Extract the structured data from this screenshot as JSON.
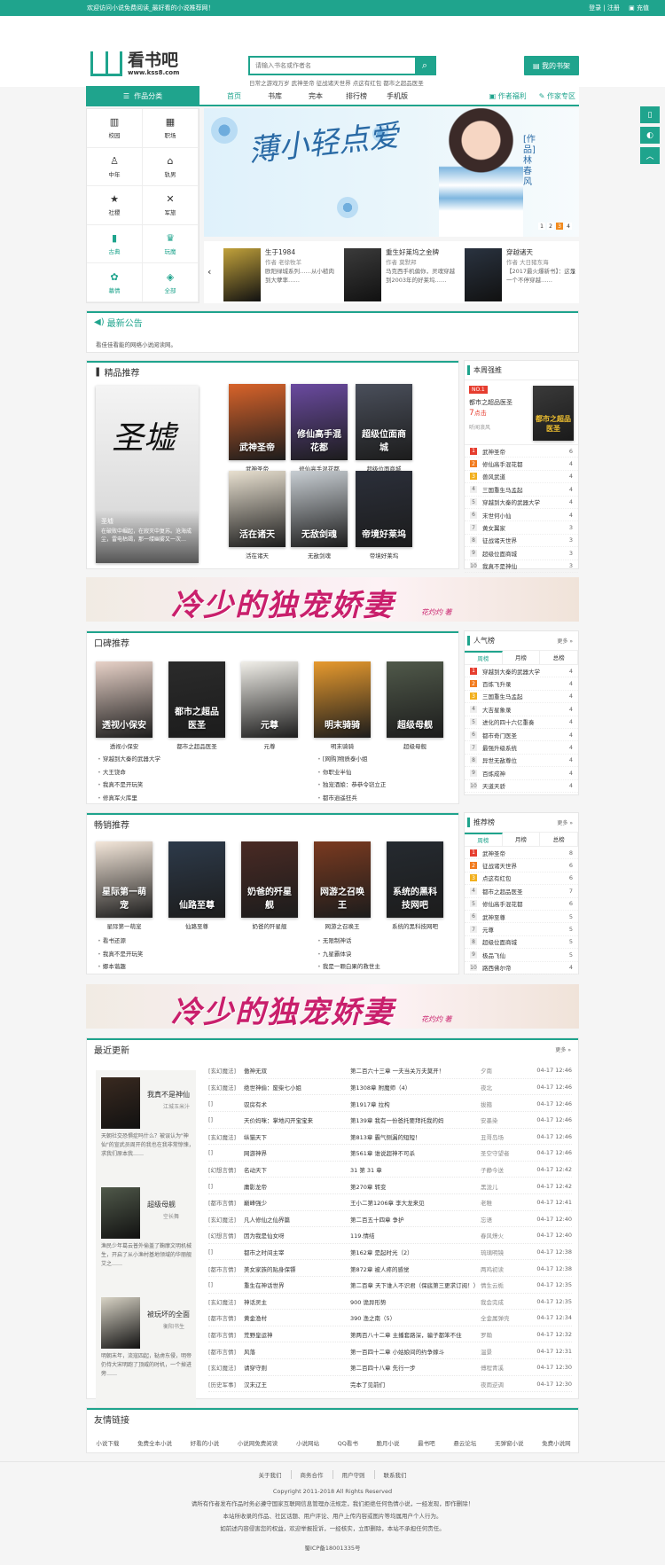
{
  "topbar": {
    "welcome": "欢迎访问小说免费阅读_最好看的小说推荐网！",
    "login": "登录 | 注册",
    "recharge": "充值"
  },
  "logo": {
    "name": "看书吧",
    "url": "www.kss8.com"
  },
  "search": {
    "placeholder": "请输入书名或作者名",
    "hotwords": "日常之游戏万岁  武神圣帝  征战诸天世界  点这有红包  都市之超品医圣"
  },
  "shelf_label": "我的书架",
  "nav": {
    "category": "作品分类",
    "items": [
      "首页",
      "书库",
      "完本",
      "排行榜",
      "手机版"
    ],
    "right": [
      "作者福利",
      "作家专区"
    ]
  },
  "categories": [
    {
      "label": "校园",
      "icon": "▥",
      "hl": false
    },
    {
      "label": "职场",
      "icon": "▦",
      "hl": false
    },
    {
      "label": "中年",
      "icon": "♙",
      "hl": false
    },
    {
      "label": "轨男",
      "icon": "⌂",
      "hl": false
    },
    {
      "label": "社稷",
      "icon": "★",
      "hl": false
    },
    {
      "label": "军旅",
      "icon": "✕",
      "hl": false
    },
    {
      "label": "古典",
      "icon": "▮",
      "hl": true
    },
    {
      "label": "玩魔",
      "icon": "♛",
      "hl": true
    },
    {
      "label": "幕情",
      "icon": "✿",
      "hl": true
    },
    {
      "label": "全部",
      "icon": "◈",
      "hl": true
    }
  ],
  "banner": {
    "title": "薄小轻点爱",
    "author": "[作品]林春风",
    "pages": [
      "1",
      "2",
      "3",
      "4"
    ],
    "active_page": "3"
  },
  "carousel": [
    {
      "title": "生于1984",
      "author": "作者 老徐牧羊",
      "desc": "欧阳绿城系列……从小糙肉到大孽率……",
      "cover": "#c2a23b"
    },
    {
      "title": "重生好莱坞之金牌",
      "author": "作者 莫默邦",
      "desc": "马克西手机偏你，灵魂穿越到2003年的好莱坞……",
      "cover": "#3b3b3b"
    },
    {
      "title": "穿越诸天",
      "author": "作者 大日猪东海",
      "desc": "【2017最火爆新书】：这是一个不停穿越……",
      "cover": "#2a3340"
    }
  ],
  "notice": {
    "title": "最新公告",
    "text": "看佳佳看能的网络小说阅读网。"
  },
  "featured": {
    "title": "精品推荐",
    "main": {
      "title": "圣墟",
      "desc": "在破败中崛起，在寂灭中复苏。沧海成尘，雷电枯竭，那一缕幽雾又一次…"
    },
    "books": [
      {
        "title": "武神圣帝",
        "color": "#d8632a"
      },
      {
        "title": "修仙高手混花都",
        "color": "#6a4aa0"
      },
      {
        "title": "超级位面商城",
        "color": "#4a4f5b"
      },
      {
        "title": "活在诸天",
        "color": "#e8e0d0"
      },
      {
        "title": "无敌剑魂",
        "color": "#c8ced3"
      },
      {
        "title": "帝境好莱坞",
        "color": "#2b2f3a"
      }
    ]
  },
  "weekly_rank": {
    "title": "本周强推",
    "top": {
      "badge": "NO.1",
      "title": "都市之超品医圣",
      "count": "7",
      "count_unit": "点击",
      "note": "听闻浪风"
    },
    "rows": [
      {
        "n": "1",
        "t": "武神圣帝",
        "c": "6"
      },
      {
        "n": "2",
        "t": "修仙高手混花都",
        "c": "4"
      },
      {
        "n": "3",
        "t": "兽风武道",
        "c": "4"
      },
      {
        "n": "4",
        "t": "三国重生马孟起",
        "c": "4"
      },
      {
        "n": "5",
        "t": "穿越到大秦的武器大学",
        "c": "4"
      },
      {
        "n": "6",
        "t": "末世何小仙",
        "c": "4"
      },
      {
        "n": "7",
        "t": "黄女翼家",
        "c": "3"
      },
      {
        "n": "8",
        "t": "征战诸天世界",
        "c": "3"
      },
      {
        "n": "9",
        "t": "超级位面商城",
        "c": "3"
      },
      {
        "n": "10",
        "t": "我真不是神仙",
        "c": "3"
      }
    ]
  },
  "ad": {
    "text": "冷少的独宠娇妻",
    "sub": "花灼灼 著"
  },
  "reputation": {
    "title": "口碑推荐",
    "books": [
      {
        "title": "透视小保安",
        "color": "#e8d2c8"
      },
      {
        "title": "都市之超品医圣",
        "color": "#2b2b2b"
      },
      {
        "title": "元尊",
        "color": "#f1efe9"
      },
      {
        "title": "明末骑骑",
        "color": "#e79a2e"
      },
      {
        "title": "超级母舰",
        "color": "#50594a"
      }
    ],
    "left": [
      "穿越到大秦的武器大学",
      "大王饶命",
      "我真不是开玩笑",
      "修真军火库里"
    ],
    "right": [
      "[网购]物质泰小姐",
      "你职业半仙",
      "独宠酒娘：恭恭令窃立正",
      "都市逍遥狂兵"
    ]
  },
  "popular_rank": {
    "title": "人气榜",
    "more": "更多 »",
    "tabs": [
      "周榜",
      "月榜",
      "总榜"
    ],
    "rows": [
      {
        "n": "1",
        "t": "穿越到大秦的武器大学",
        "c": "4"
      },
      {
        "n": "2",
        "t": "百炼飞升录",
        "c": "4"
      },
      {
        "n": "3",
        "t": "三国重生马孟起",
        "c": "4"
      },
      {
        "n": "4",
        "t": "大吉星象录",
        "c": "4"
      },
      {
        "n": "5",
        "t": "进化的四十六亿重奏",
        "c": "4"
      },
      {
        "n": "6",
        "t": "都市奇门医圣",
        "c": "4"
      },
      {
        "n": "7",
        "t": "最强升级系统",
        "c": "4"
      },
      {
        "n": "8",
        "t": "异世无敌尊位",
        "c": "4"
      },
      {
        "n": "9",
        "t": "百炼成神",
        "c": "4"
      },
      {
        "n": "10",
        "t": "天道天骄",
        "c": "4"
      }
    ]
  },
  "bestseller": {
    "title": "畅销推荐",
    "books": [
      {
        "title": "星际第一萌宠",
        "color": "#f4e7da"
      },
      {
        "title": "仙路至尊",
        "color": "#2d3a4a"
      },
      {
        "title": "奶爸的歼星舰",
        "color": "#4a2a24"
      },
      {
        "title": "网游之召唤王",
        "color": "#7a3a20"
      },
      {
        "title": "系统的黑科技网吧",
        "color": "#252a30"
      }
    ],
    "left": [
      "看书还源",
      "我真不是开玩笑",
      "娜本谐趣"
    ],
    "right": [
      "无限制神话",
      "九星霸体诀",
      "我是一颗白果的救世主"
    ]
  },
  "recommend_rank": {
    "title": "推荐榜",
    "more": "更多 »",
    "tabs": [
      "周榜",
      "月榜",
      "总榜"
    ],
    "rows": [
      {
        "n": "1",
        "t": "武神圣帝",
        "c": "8"
      },
      {
        "n": "2",
        "t": "征战诸天世界",
        "c": "6"
      },
      {
        "n": "3",
        "t": "点这有红包",
        "c": "6"
      },
      {
        "n": "4",
        "t": "都市之超品医圣",
        "c": "7"
      },
      {
        "n": "5",
        "t": "修仙高手混花都",
        "c": "6"
      },
      {
        "n": "6",
        "t": "武神至尊",
        "c": "5"
      },
      {
        "n": "7",
        "t": "元尊",
        "c": "5"
      },
      {
        "n": "8",
        "t": "超级位面商城",
        "c": "5"
      },
      {
        "n": "9",
        "t": "极品飞仙",
        "c": "5"
      },
      {
        "n": "10",
        "t": "路西佛尔帝",
        "c": "4"
      }
    ]
  },
  "updates": {
    "title": "最近更新",
    "more": "更多 »",
    "featured": [
      {
        "title": "我真不是神仙",
        "author": "江城玉米汁",
        "desc": "天朝社交恐惧症吗什么？被误认为\"神仙\"的宣武员周开的我也在我非常惊悚，求我们原本我……",
        "color": "#3a2a20"
      },
      {
        "title": "超级母舰",
        "author": "空长舞",
        "desc": "渔民少年葛云普外偷盖了鞠摩文明机械生，开启了从小渔村基地领域的华丽舰艾之……",
        "color": "#50594a"
      },
      {
        "title": "被玩坏的全面",
        "author": "衡阳书生",
        "desc": "明朝末年，流寇四起，鞑虏东侵，明帝仍恃大宋明跑了顶威的时机，一个掉进旁……",
        "color": "#d9d4c6"
      }
    ],
    "rows": [
      {
        "cat": "[玄幻魔法]",
        "book": "傲神无双",
        "chapter": "第二百六十三章 一夫当关万夫莫开！",
        "author": "夕南",
        "time": "04-17 12:46"
      },
      {
        "cat": "[玄幻魔法]",
        "book": "绝世神偷：废柴七小姐",
        "chapter": "第1308章 附魔师（4）",
        "author": "夜北",
        "time": "04-17 12:46"
      },
      {
        "cat": "[]",
        "book": "驭房有术",
        "chapter": "第1917章 拉构",
        "author": "拔箍",
        "time": "04-17 12:46"
      },
      {
        "cat": "[]",
        "book": "天价妈咪：掌地闪开宝宝来",
        "chapter": "第139章 我有一份爸托要拜托我的妈",
        "author": "安墨染",
        "time": "04-17 12:46"
      },
      {
        "cat": "[玄幻魔法]",
        "book": "纵猫天下",
        "chapter": "第813章 霸气侧漏的短短！",
        "author": "丑哥岛场",
        "time": "04-17 12:46"
      },
      {
        "cat": "[]",
        "book": "网游神界",
        "chapter": "第561章 谁说超神不可杀",
        "author": "圣空守望者",
        "time": "04-17 12:46"
      },
      {
        "cat": "[幻想言情]",
        "book": "名动天下",
        "chapter": "31 第 31 章",
        "author": "子静今送",
        "time": "04-17 12:42"
      },
      {
        "cat": "[]",
        "book": "庸影龙帝",
        "chapter": "第270章 转变",
        "author": "黑泷儿",
        "time": "04-17 12:42"
      },
      {
        "cat": "[都市言情]",
        "book": "巅峰强少",
        "chapter": "王小二第1206章 李大龙来见",
        "author": "老稚",
        "time": "04-17 12:41"
      },
      {
        "cat": "[玄幻魔法]",
        "book": "凡人修仙之仙界篇",
        "chapter": "第二百五十四章 争护",
        "author": "忘语",
        "time": "04-17 12:40"
      },
      {
        "cat": "[幻想言情]",
        "book": "因为我是仙女呀",
        "chapter": "119.情结",
        "author": "春风燎火",
        "time": "04-17 12:40"
      },
      {
        "cat": "[]",
        "book": "都市之时间主宰",
        "chapter": "第162章 是起时光（2）",
        "author": "琉璃明镜",
        "time": "04-17 12:38"
      },
      {
        "cat": "[都市言情]",
        "book": "美女家族的贴身保镖",
        "chapter": "第872章 被人疼的感觉",
        "author": "两鸡初读",
        "time": "04-17 12:38"
      },
      {
        "cat": "[]",
        "book": "重生在神话世界",
        "chapter": "第二百章 天下谁人不识君（保底第三更求订阅！）",
        "author": "情生云栀",
        "time": "04-17 12:35"
      },
      {
        "cat": "[玄幻魔法]",
        "book": "神话灵主",
        "chapter": "900 诡异形势",
        "author": "我会完成",
        "time": "04-17 12:35"
      },
      {
        "cat": "[都市言情]",
        "book": "黄金渔村",
        "chapter": "390 渔之南（5）",
        "author": "全金属弹壳",
        "time": "04-17 12:34"
      },
      {
        "cat": "[都市言情]",
        "book": "荒野皇运神",
        "chapter": "第两百八十二章 主播套路深，骗子都笨不住",
        "author": "罗翰",
        "time": "04-17 12:32"
      },
      {
        "cat": "[都市言情]",
        "book": "风落",
        "chapter": "第一百四十二章 小姑娘间的约争嫁斗",
        "author": "温景",
        "time": "04-17 12:31"
      },
      {
        "cat": "[玄幻魔法]",
        "book": "请穿守则",
        "chapter": "第二百四十八章 先行一步",
        "author": "傅程青溪",
        "time": "04-17 12:30"
      },
      {
        "cat": "[历史军事]",
        "book": "汉末辽王",
        "chapter": "完本了见前们",
        "author": "夜雨逆调",
        "time": "04-17 12:30"
      }
    ]
  },
  "links": {
    "title": "友情链接",
    "items": [
      "小说下载",
      "免费全本小说",
      "好看的小说",
      "小说网免费阅读",
      "小说网站",
      "QQ看书",
      "脆月小说",
      "最书吧",
      "悬云论坛",
      "无弹窗小说",
      "免费小说网"
    ]
  },
  "footer": {
    "links": [
      "关于我们",
      "商务合作",
      "用户守则",
      "联系我们"
    ],
    "copyright": "Copyright 2011-2018 All Rights Reserved",
    "line1": "请所有作者发布作品时务必遵守国家互联网信息管理办法规定，我们拒绝任何色情小说，一经发现，即作删除！",
    "line2": "本站所收录的作品、社区话题、用户评论、用户上传内容或图片等均属用户个人行为。",
    "line3": "如前述内容侵害您的权益，欢迎举报投诉，一经核实，立即删除，本站不承担任何责任。",
    "icp": "蜀ICP备18001335号"
  }
}
